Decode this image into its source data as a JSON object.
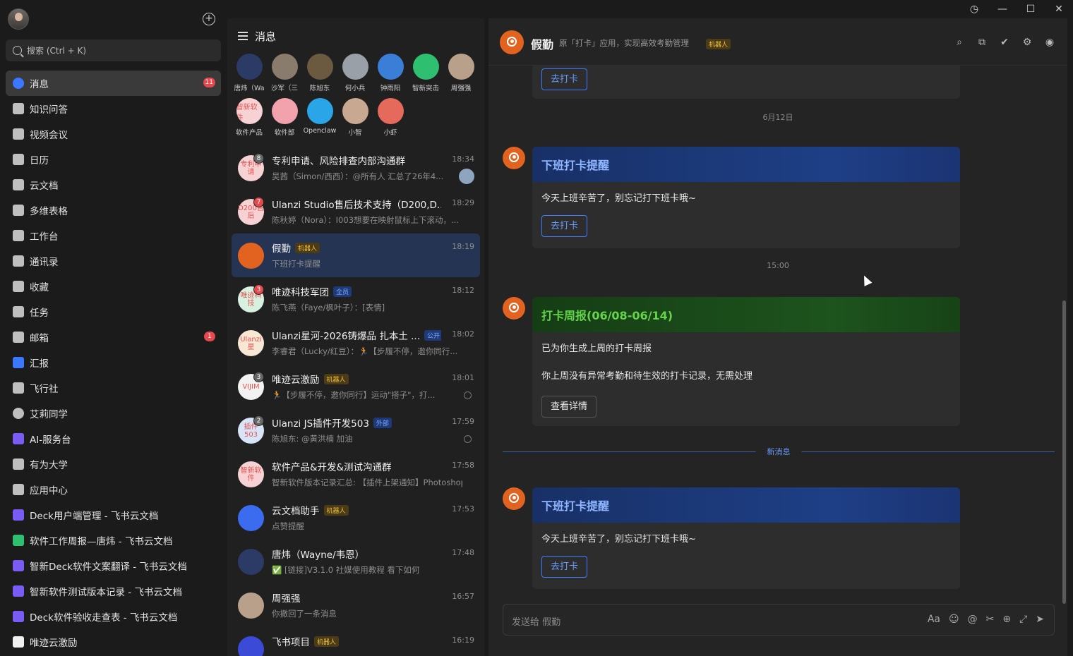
{
  "window": {
    "history_icon": "history-icon",
    "minimize": "—",
    "maximize": "☐",
    "close": "✕"
  },
  "sidebar": {
    "search_placeholder": "搜索 (Ctrl + K)",
    "items": [
      {
        "label": "消息",
        "icon": "message-icon",
        "badge": "11",
        "active": true
      },
      {
        "label": "知识问答",
        "icon": "knowledge-icon"
      },
      {
        "label": "视频会议",
        "icon": "video-icon"
      },
      {
        "label": "日历",
        "icon": "calendar-icon"
      },
      {
        "label": "云文档",
        "icon": "doc-icon"
      },
      {
        "label": "多维表格",
        "icon": "table-icon"
      },
      {
        "label": "工作台",
        "icon": "workspace-icon"
      },
      {
        "label": "通讯录",
        "icon": "contacts-icon"
      },
      {
        "label": "收藏",
        "icon": "star-icon"
      },
      {
        "label": "任务",
        "icon": "task-icon"
      },
      {
        "label": "邮箱",
        "icon": "mail-icon",
        "badge": "1"
      },
      {
        "label": "汇报",
        "icon": "report-icon"
      },
      {
        "label": "飞行社",
        "icon": "flight-icon"
      },
      {
        "label": "艾莉同学",
        "icon": "ally-icon"
      },
      {
        "label": "AI-服务台",
        "icon": "ai-icon"
      },
      {
        "label": "有为大学",
        "icon": "university-icon"
      },
      {
        "label": "应用中心",
        "icon": "apps-icon"
      },
      {
        "label": "Deck用户端管理 - 飞书云文档",
        "icon": "doc-purple-icon"
      },
      {
        "label": "软件工作周报—唐炜 - 飞书云文档",
        "icon": "sheet-green-icon"
      },
      {
        "label": "智新Deck软件文案翻译 - 飞书云文档",
        "icon": "doc-purple-icon"
      },
      {
        "label": "智新软件测试版本记录 - 飞书云文档",
        "icon": "doc-purple-icon"
      },
      {
        "label": "Deck软件验收走查表 - 飞书云文档",
        "icon": "doc-purple-icon"
      },
      {
        "label": "唯迹云激励",
        "icon": "vijim-icon"
      }
    ]
  },
  "list": {
    "title": "消息",
    "pinned": [
      {
        "label": "唐炜（Wa",
        "color": "#2c3a66"
      },
      {
        "label": "沙军（三",
        "color": "#8a7c6c"
      },
      {
        "label": "陈旭东",
        "color": "#6b5a40"
      },
      {
        "label": "何小兵",
        "color": "#9aa0a8"
      },
      {
        "label": "钟雨阳",
        "color": "#3a7ed8"
      },
      {
        "label": "智新突击",
        "color": "#2fbf71"
      },
      {
        "label": "周强强",
        "color": "#b8a08a"
      },
      {
        "label": "软件产品",
        "text": "智新软件",
        "color": "#f6d2d4"
      },
      {
        "label": "软件部",
        "color": "#f2a2ac"
      },
      {
        "label": "Openclaw",
        "color": "#2aa6e8"
      },
      {
        "label": "小智",
        "color": "#c9a891"
      },
      {
        "label": "小虾",
        "color": "#e56a5c"
      }
    ],
    "chats": [
      {
        "title": "专利申请、风险排查内部沟通群",
        "msg": "吴茜（Simon/西西）：@所有人 汇总了26年4...",
        "time": "18:34",
        "count": "8",
        "avatar_text": "专利申请",
        "avatar_bg": "#f6d2d4"
      },
      {
        "title": "Ulanzi Studio售后技术支持（D200,D...",
        "msg": "陈秋婷（Nora）：I003想要在映射鼠标上下滚动，...",
        "time": "18:29",
        "count": "7",
        "count_red": true,
        "avatar_text": "D200售后",
        "avatar_bg": "#f6d2d4"
      },
      {
        "title": "假勤",
        "tag": "机器人",
        "msg": "下班打卡提醒",
        "time": "18:19",
        "active": true,
        "avatar_bg": "#e2631f"
      },
      {
        "title": "唯迹科技军团",
        "tag_all": "全员",
        "msg": "陈飞燕（Faye/枫叶子）：[表情]",
        "time": "18:12",
        "count": "3",
        "count_red": true,
        "avatar_text": "唯迹科技",
        "avatar_bg": "#d8f0e0"
      },
      {
        "title": "Ulanzi星河-2026铸爆品 扎本土 ...",
        "tag_pub": "公开",
        "msg": "李睿君（Lucky/红豆）：🏃【步履不停，邀你同行...",
        "time": "18:02",
        "avatar_text": "Ulanzi星",
        "avatar_bg": "#f7e7d4"
      },
      {
        "title": "唯迹云激励",
        "tag": "机器人",
        "msg": "🏃【步履不停，邀你同行】运动\"搭子\"，打...",
        "time": "18:01",
        "count": "3",
        "avatar_text": "VIJIM",
        "avatar_bg": "#f2f2f2"
      },
      {
        "title": "Ulanzi JS插件开发503",
        "tag_ext": "外部",
        "msg": "陈旭东: @黄洪楠 加油",
        "time": "17:59",
        "count": "2",
        "avatar_text": "插件503",
        "avatar_bg": "#d8e4f7"
      },
      {
        "title": "软件产品&开发&测试沟通群",
        "msg": "智新软件版本记录汇总: 【插件上架通知】Photoshop",
        "time": "17:58",
        "avatar_text": "智新软件",
        "avatar_bg": "#f6d2d4"
      },
      {
        "title": "云文档助手",
        "tag": "机器人",
        "msg": "点赞提醒",
        "time": "17:53",
        "avatar_bg": "#3b6cf0"
      },
      {
        "title": "唐炜（Wayne/韦恩）",
        "msg": "✅ [链接]V3.1.0 社媒使用教程 看下如何",
        "time": "17:48",
        "avatar_bg": "#2c3a66"
      },
      {
        "title": "周强强",
        "msg": "你撤回了一条消息",
        "time": "16:57",
        "avatar_bg": "#b8a08a"
      },
      {
        "title": "飞书项目",
        "tag": "机器人",
        "msg": "",
        "time": "16:19",
        "avatar_bg": "#3b4bd8"
      }
    ]
  },
  "panel": {
    "title": "假勤",
    "desc": "原「打卡」应用，实现高效考勤管理",
    "tag": "机器人",
    "top_button": "去打卡",
    "date1": "6月12日",
    "card1": {
      "title": "下班打卡提醒",
      "body": "今天上班辛苦了，别忘记打下班卡哦~",
      "button": "去打卡"
    },
    "time2": "15:00",
    "card2": {
      "title": "打卡周报(06/08-06/14)",
      "line1": "已为你生成上周的打卡周报",
      "line2": "你上周没有异常考勤和待生效的打卡记录，无需处理",
      "button": "查看详情"
    },
    "new_label": "新消息",
    "card3": {
      "title": "下班打卡提醒",
      "body": "今天上班辛苦了，别忘记打下班卡哦~",
      "button": "去打卡"
    },
    "composer_placeholder": "发送给 假勤"
  }
}
